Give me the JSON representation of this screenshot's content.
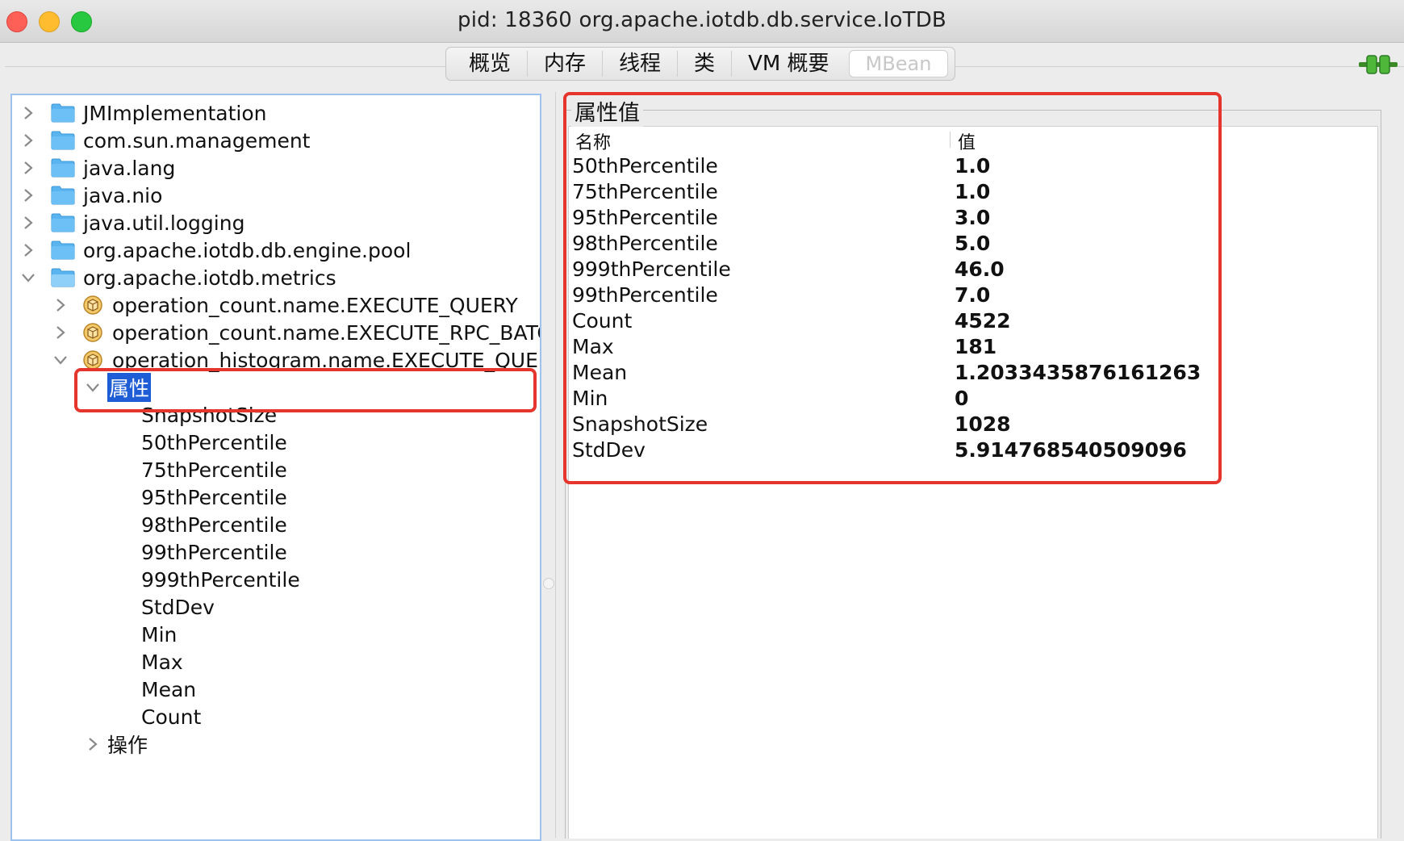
{
  "window": {
    "title": "pid: 18360 org.apache.iotdb.db.service.IoTDB"
  },
  "tabs": [
    {
      "label": "概览"
    },
    {
      "label": "内存"
    },
    {
      "label": "线程"
    },
    {
      "label": "类"
    },
    {
      "label": "VM 概要"
    },
    {
      "label": "MBean"
    }
  ],
  "tree": {
    "domains": [
      {
        "label": "JMImplementation"
      },
      {
        "label": "com.sun.management"
      },
      {
        "label": "java.lang"
      },
      {
        "label": "java.nio"
      },
      {
        "label": "java.util.logging"
      },
      {
        "label": "org.apache.iotdb.db.engine.pool"
      },
      {
        "label": "org.apache.iotdb.metrics"
      }
    ],
    "beans": [
      {
        "label": "operation_count.name.EXECUTE_QUERY"
      },
      {
        "label": "operation_count.name.EXECUTE_RPC_BATCH_"
      },
      {
        "label": "operation_histogram.name.EXECUTE_QUERY"
      }
    ],
    "attributes_label": "属性",
    "attributes": [
      "SnapshotSize",
      "50thPercentile",
      "75thPercentile",
      "95thPercentile",
      "98thPercentile",
      "99thPercentile",
      "999thPercentile",
      "StdDev",
      "Min",
      "Max",
      "Mean",
      "Count"
    ],
    "operations_label": "操作"
  },
  "attr_panel": {
    "title": "属性值",
    "col_name": "名称",
    "col_value": "值",
    "rows": [
      {
        "name": "50thPercentile",
        "value": "1.0"
      },
      {
        "name": "75thPercentile",
        "value": "1.0"
      },
      {
        "name": "95thPercentile",
        "value": "3.0"
      },
      {
        "name": "98thPercentile",
        "value": "5.0"
      },
      {
        "name": "999thPercentile",
        "value": "46.0"
      },
      {
        "name": "99thPercentile",
        "value": "7.0"
      },
      {
        "name": "Count",
        "value": "4522"
      },
      {
        "name": "Max",
        "value": "181"
      },
      {
        "name": "Mean",
        "value": "1.2033435876161263"
      },
      {
        "name": "Min",
        "value": "0"
      },
      {
        "name": "SnapshotSize",
        "value": "1028"
      },
      {
        "name": "StdDev",
        "value": "5.914768540509096"
      }
    ]
  },
  "colors": {
    "annotation": "#e5352c",
    "selection": "#1e5dd6",
    "folder": "#5ab4f0"
  }
}
